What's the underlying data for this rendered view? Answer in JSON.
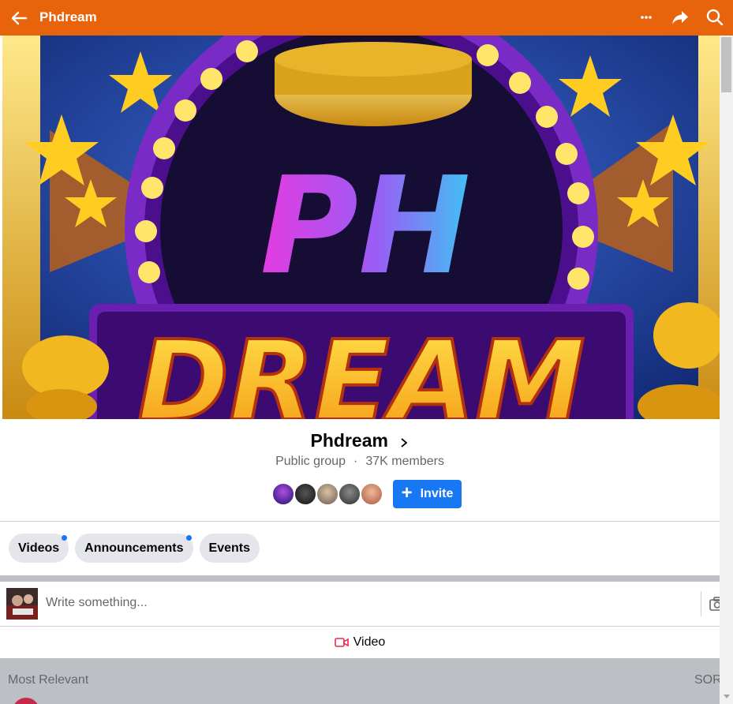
{
  "topbar": {
    "title": "Phdream",
    "color": "#e8640c",
    "icons": [
      "back-arrow-icon",
      "more-icon",
      "share-icon",
      "search-icon"
    ]
  },
  "cover": {
    "logo_line1": "PH",
    "logo_line2": "DREAM"
  },
  "group": {
    "name": "Phdream",
    "privacy": "Public group",
    "separator": "·",
    "members": "37K members"
  },
  "invite": {
    "plus": "+",
    "label": "Invite",
    "color": "#1877f2"
  },
  "chips": [
    {
      "label": "Videos",
      "badge": true
    },
    {
      "label": "Announcements",
      "badge": true
    },
    {
      "label": "Events",
      "badge": false
    }
  ],
  "composer": {
    "placeholder": "Write something..."
  },
  "video_action": {
    "label": "Video"
  },
  "sort": {
    "label": "Most Relevant",
    "action": "SORT"
  }
}
